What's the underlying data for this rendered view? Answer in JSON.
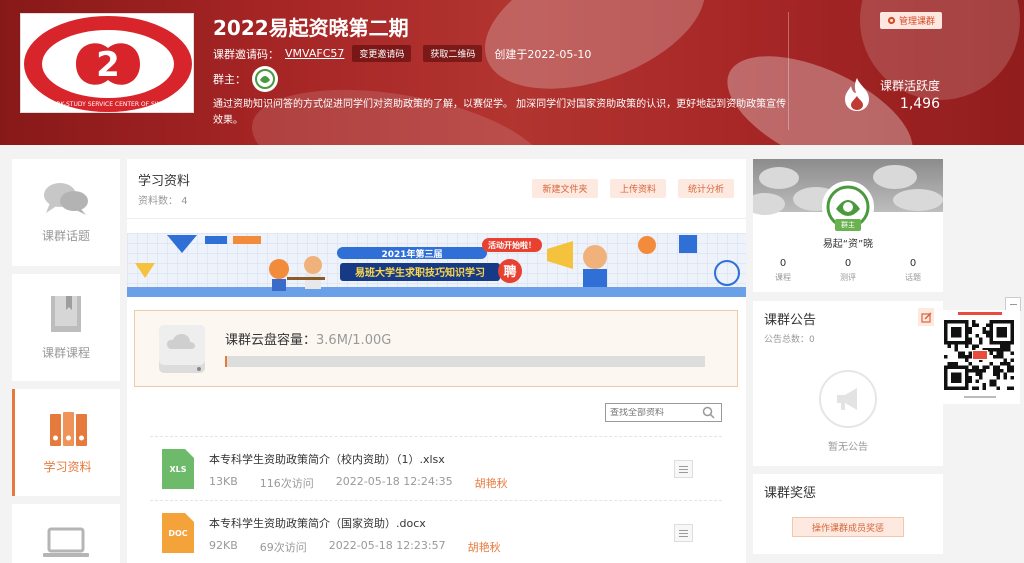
{
  "header": {
    "title": "2022易起资晓第二期",
    "invite_label": "课群邀请码：",
    "invite_code": "VMVAFC57",
    "change_code_button": "变更邀请码",
    "get_qr_button": "获取二维码",
    "created_text": "创建于2022-05-10",
    "owner_label": "群主：",
    "description": "通过资助知识问答的方式促进同学们对资助政策的了解，以赛促学。 加深同学们对国家资助政策的认识，更好地起到资助政策宣传效果。",
    "manage_button": "管理课群",
    "activity_label": "课群活跃度",
    "activity_value": "1,496",
    "logo_ring_text": "WORK-STUDY SERVICE CENTER OF SWMU"
  },
  "sidebar": {
    "items": [
      {
        "label": "课群话题",
        "icon": "chat-bubbles-icon",
        "active": false
      },
      {
        "label": "课群课程",
        "icon": "book-icon",
        "active": false
      },
      {
        "label": "学习资料",
        "icon": "binders-icon",
        "active": true
      },
      {
        "label": "",
        "icon": "laptop-icon",
        "active": false
      }
    ]
  },
  "materials": {
    "title": "学习资料",
    "count_label": "资料数：",
    "count": "4",
    "buttons": {
      "new_folder": "新建文件夹",
      "upload": "上传资料",
      "stats": "统计分析"
    },
    "banner": {
      "year_label": "2021年第三届",
      "tag": "活动开始啦！",
      "headline": "易班大学生求职技巧知识学习",
      "badge": "聘"
    },
    "storage": {
      "label": "课群云盘容量：",
      "value": "3.6M/1.00G",
      "used_fraction": 0.0035
    },
    "search_placeholder": "查找全部资料",
    "files": [
      {
        "type": "XLS",
        "name": "本专科学生资助政策简介（校内资助）（1）.xlsx",
        "size": "13KB",
        "visits": "116次访问",
        "date": "2022-05-18 12:24:35",
        "owner": "胡艳秋",
        "color": "#6dbb6a"
      },
      {
        "type": "DOC",
        "name": "本专科学生资助政策简介（国家资助）.docx",
        "size": "92KB",
        "visits": "69次访问",
        "date": "2022-05-18 12:23:57",
        "owner": "胡艳秋",
        "color": "#f3a33a"
      }
    ]
  },
  "profile": {
    "badge": "群主",
    "name": "易起“资”晓",
    "stats": [
      {
        "value": "0",
        "label": "课程"
      },
      {
        "value": "0",
        "label": "测评"
      },
      {
        "value": "0",
        "label": "话题"
      }
    ]
  },
  "notice": {
    "title": "课群公告",
    "count_label": "公告总数：",
    "count": "0",
    "empty": "暂无公告"
  },
  "award": {
    "title": "课群奖惩",
    "button": "操作课群成员奖惩"
  },
  "colors": {
    "accent": "#e67a3c",
    "banner_red": "#b42a2a"
  }
}
